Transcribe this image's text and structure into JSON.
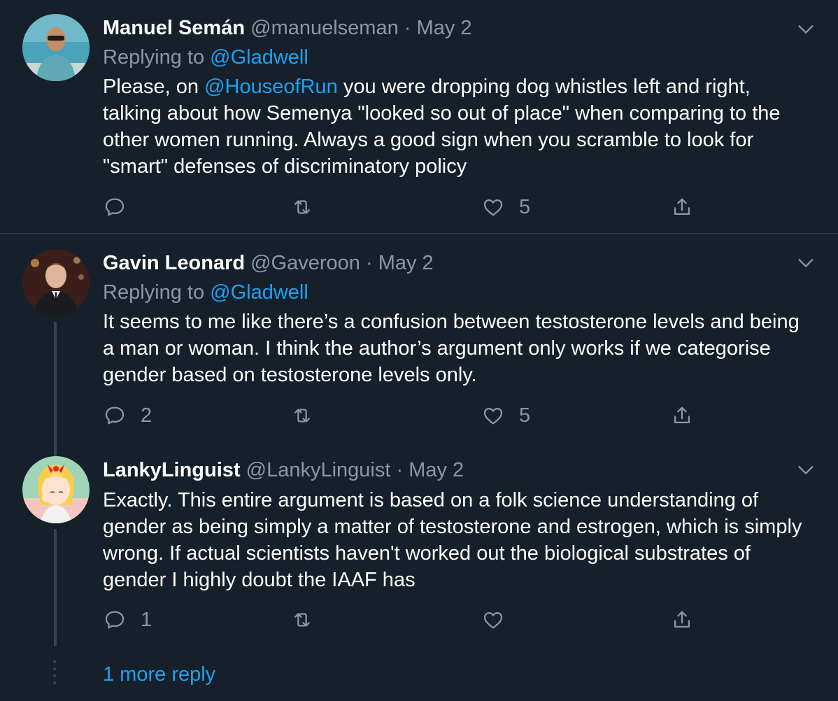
{
  "tweets": [
    {
      "name": "Manuel Semán",
      "handle": "@manuelseman",
      "dot": "·",
      "date": "May 2",
      "replying_prefix": "Replying to",
      "replying_to": "@Gladwell",
      "body_before": "Please, on ",
      "body_mention": "@HouseofRun",
      "body_after": " you were dropping dog whistles left and right, talking about how Semenya \"looked so out of place\" when comparing to the other women running. Always a good sign when you scramble to look for  \"smart\" defenses of discriminatory policy",
      "reply_count": "",
      "retweet_count": "",
      "like_count": "5"
    },
    {
      "name": "Gavin Leonard",
      "handle": "@Gaveroon",
      "dot": "·",
      "date": "May 2",
      "replying_prefix": "Replying to",
      "replying_to": "@Gladwell",
      "body": "It seems to me like there’s a confusion between testosterone levels and being a man or woman. I think the author’s argument only works if we categorise gender based on testosterone levels only.",
      "reply_count": "2",
      "retweet_count": "",
      "like_count": "5"
    },
    {
      "name": "LankyLinguist",
      "handle": "@LankyLinguist",
      "dot": "·",
      "date": "May 2",
      "body": "Exactly. This entire argument is based on a folk science understanding of gender as being simply a matter of testosterone and estrogen, which is simply wrong. If actual scientists haven't worked out the biological substrates of gender I highly doubt the IAAF has",
      "reply_count": "1",
      "retweet_count": "",
      "like_count": ""
    }
  ],
  "more_replies": "1 more reply",
  "colors": {
    "background": "#15202b",
    "text": "#ffffff",
    "secondary": "#8899a6",
    "link": "#1da1f2",
    "border": "#38444d"
  },
  "icons": [
    "reply-icon",
    "retweet-icon",
    "like-icon",
    "share-icon",
    "chevron-down-icon"
  ]
}
